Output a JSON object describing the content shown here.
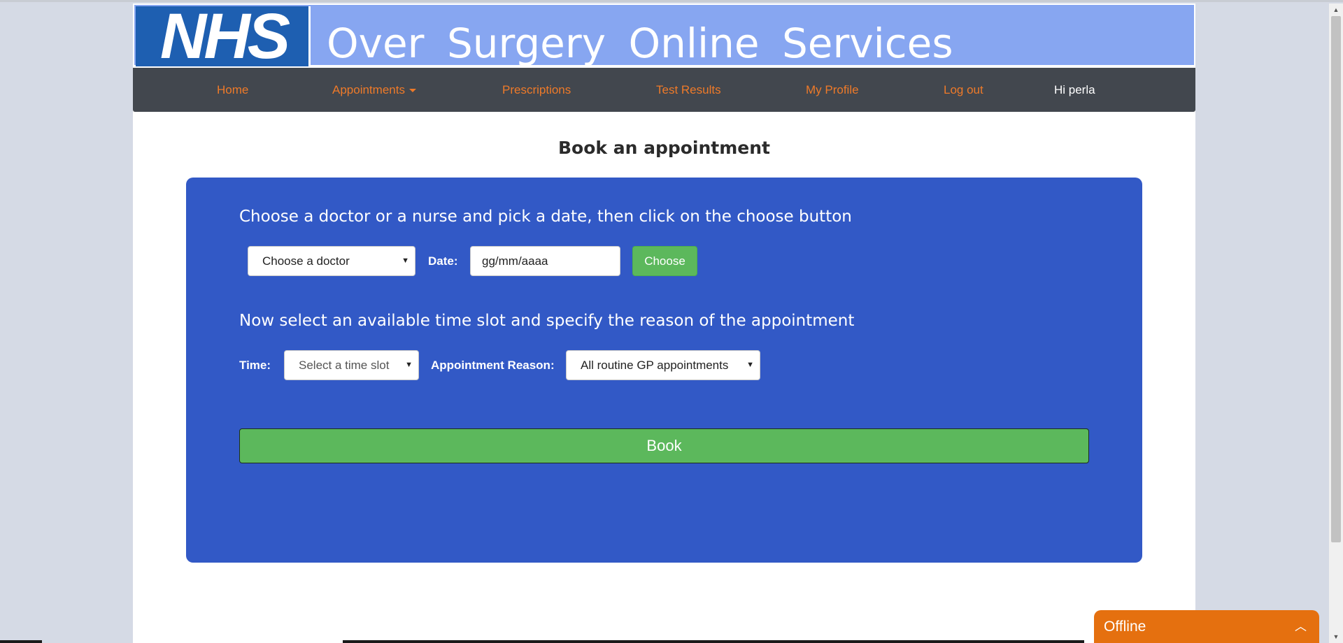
{
  "banner": {
    "logo_text": "NHS",
    "title": "Over Surgery Online Services",
    "colors": {
      "banner": "#87a6f1",
      "logo": "#1e5fb1"
    }
  },
  "nav": {
    "items": [
      {
        "label": "Home"
      },
      {
        "label": "Appointments"
      },
      {
        "label": "Prescriptions"
      },
      {
        "label": "Test Results"
      },
      {
        "label": "My Profile"
      },
      {
        "label": "Log out"
      }
    ],
    "greeting": "Hi perla",
    "colors": {
      "background": "#42474e",
      "link": "#ee7a29"
    }
  },
  "main": {
    "title": "Book an appointment",
    "step1": {
      "instruction": "Choose a doctor or a nurse and pick a date, then click on the choose button",
      "doctor_select": "Choose a doctor",
      "date_label": "Date:",
      "date_placeholder": "gg/mm/aaaa",
      "choose_label": "Choose"
    },
    "step2": {
      "instruction": "Now select an available time slot and specify the reason of the appointment",
      "time_label": "Time:",
      "time_select": "Select a time slot",
      "reason_label": "Appointment Reason:",
      "reason_select": "All routine GP appointments"
    },
    "book_label": "Book",
    "colors": {
      "panel": "#3259c6",
      "button": "#5cb85c"
    }
  },
  "widgets": {
    "offline_label": "Offline",
    "offline_color": "#e5700f",
    "chevron_icon": "chevron-up-icon",
    "caret_icon": "caret-down-icon"
  }
}
